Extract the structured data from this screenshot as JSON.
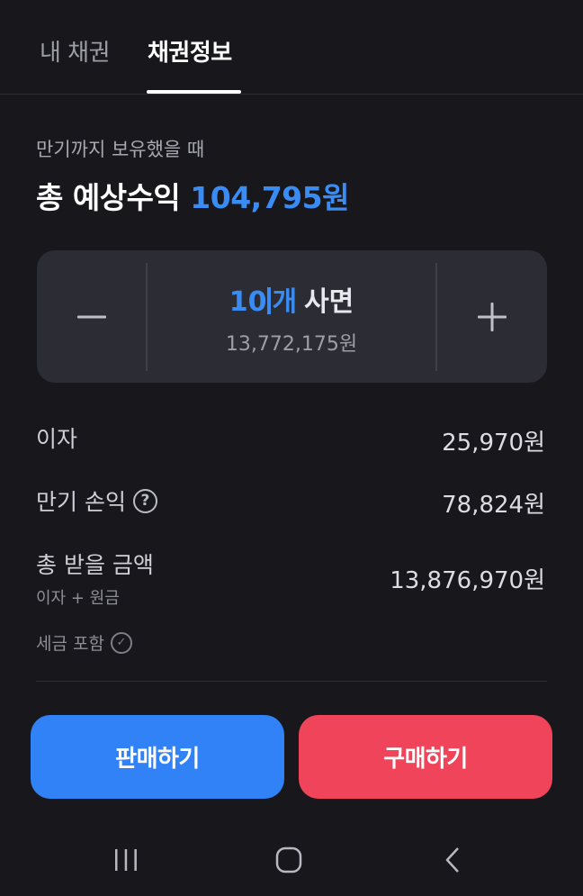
{
  "tabs": [
    {
      "label": "내 채권",
      "active": false
    },
    {
      "label": "채권정보",
      "active": true
    }
  ],
  "summary": {
    "subtitle": "만기까지 보유했을 때",
    "title_prefix": "총 예상수익",
    "title_amount": "104,795원"
  },
  "stepper": {
    "qty_number": "10",
    "qty_unit": "개",
    "action": "사면",
    "price": "13,772,175원"
  },
  "rows": {
    "interest": {
      "label": "이자",
      "value": "25,970원"
    },
    "maturity": {
      "label": "만기 손익",
      "value": "78,824원"
    },
    "total": {
      "label": "총 받을 금액",
      "sub": "이자 + 원금",
      "value": "13,876,970원"
    }
  },
  "tax_note": "세금 포함",
  "buttons": {
    "sell": "판매하기",
    "buy": "구매하기"
  },
  "colors": {
    "accent_blue": "#3a8cf5",
    "sell_button": "#3182f6",
    "buy_button": "#f0445a",
    "background": "#17171c"
  },
  "icons": {
    "help": "question-circle-icon",
    "check": "check-circle-icon",
    "minus": "minus-icon",
    "plus": "plus-icon"
  }
}
